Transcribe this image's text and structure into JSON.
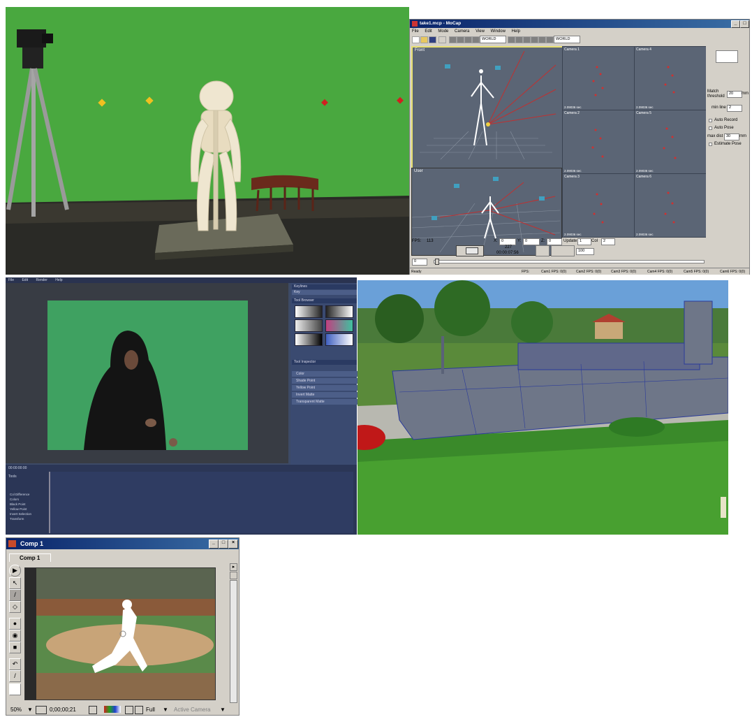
{
  "mocap": {
    "title": "take1.mcp - MoCap",
    "menu": [
      "File",
      "Edit",
      "Mode",
      "Camera",
      "View",
      "Window",
      "Help"
    ],
    "coord_selects": [
      "WORLD",
      "WORLD"
    ],
    "views": [
      "Front",
      "User"
    ],
    "cameras": [
      {
        "label": "Camera 1",
        "time": "2.09036 sec"
      },
      {
        "label": "Camera 4",
        "time": "2.09036 sec"
      },
      {
        "label": "Camera 2",
        "time": "2.09036 sec"
      },
      {
        "label": "Camera 5",
        "time": "2.09036 sec"
      },
      {
        "label": "Camera 3",
        "time": "2.09036 sec"
      },
      {
        "label": "Camera 6",
        "time": "2.09036 sec"
      }
    ],
    "right_panel": {
      "match_threshold_label": "Match threshold",
      "match_threshold_value": "20",
      "mm": "mm",
      "min_line_label": "min line",
      "min_line_value": "2",
      "auto_record": "Auto Record",
      "auto_pose": "Auto Pose",
      "max_dist_label": "max dist",
      "max_dist_value": "30",
      "estimate_pose": "Estimate Pose"
    },
    "fps_label": "FPS:",
    "fps_value": "113",
    "x_label": "X:",
    "x_value": "0",
    "y_label": "Y:",
    "y_value": "0",
    "z_label": "Z:",
    "z_value": "0",
    "update_label": "Update",
    "update_value": "1",
    "col_label": "Col",
    "col_value": "2",
    "frame": "227",
    "timecode": "00:00:07:56",
    "speed": "100",
    "start_frame": "0",
    "status": {
      "ready": "Ready",
      "fps": "FPS:",
      "cams": [
        "Cam1 FPS: 0(0)",
        "Cam2 FPS: 0(0)",
        "Cam3 FPS: 0(0)",
        "Cam4 FPS: 0(0)",
        "Cam5 FPS: 0(0)",
        "Cam6 FPS: 0(0)"
      ]
    }
  },
  "keyer": {
    "menu": [
      "File",
      "Edit",
      "Render",
      "Help"
    ],
    "panel_tabs": [
      "Keylines",
      "Key"
    ],
    "section_tools": "Tool Browser",
    "section_inspector": "Tool Inspector",
    "inspector_rows": [
      "Color",
      "Shade Point",
      "Yellow Point",
      "Invert Matte",
      "Transparent Matte"
    ],
    "timeline_label": "Tools",
    "timeline_rows": [
      "Col Difference",
      "Colors",
      "Black Point",
      "Yellow Point",
      "Invert Selection",
      "Transform"
    ],
    "timecode": "00:00:00:00"
  },
  "ae": {
    "title": "Comp 1",
    "tab": "Comp 1",
    "zoom": "50%",
    "time": "0;00;00;21",
    "resolution": "Full",
    "camera": "Active Camera"
  }
}
